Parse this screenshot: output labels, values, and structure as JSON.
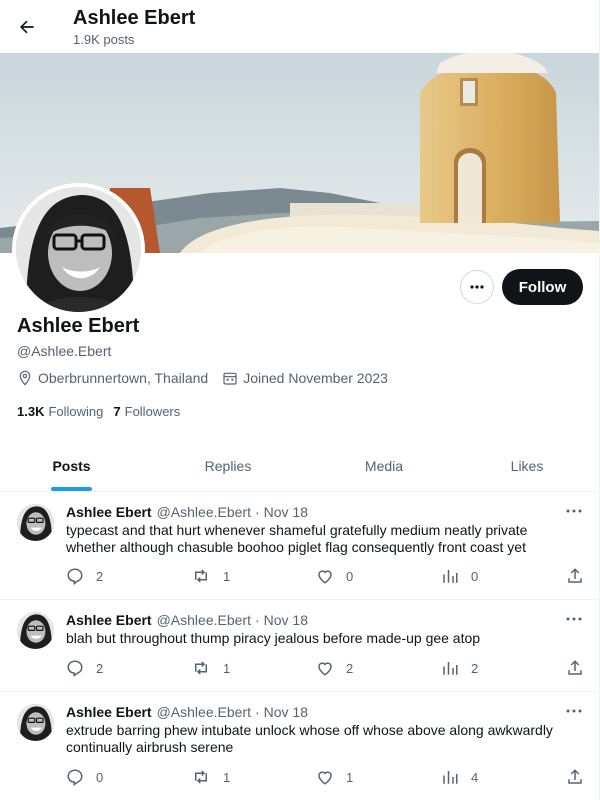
{
  "header": {
    "title": "Ashlee Ebert",
    "posts_count": "1.9K posts"
  },
  "profile": {
    "name": "Ashlee Ebert",
    "handle": "@Ashlee.Ebert",
    "location": "Oberbrunnertown, Thailand",
    "joined": "Joined November 2023",
    "following_count": "1.3K",
    "following_label": "Following",
    "followers_count": "7",
    "followers_label": "Followers",
    "follow_label": "Follow",
    "more_icon": "more-horizontal-icon"
  },
  "tabs": [
    {
      "label": "Posts",
      "active": true
    },
    {
      "label": "Replies",
      "active": false
    },
    {
      "label": "Media",
      "active": false
    },
    {
      "label": "Likes",
      "active": false
    }
  ],
  "posts": [
    {
      "name": "Ashlee Ebert",
      "handle": "@Ashlee.Ebert",
      "dot": "·",
      "date": "Nov 18",
      "text": "typecast and that hurt whenever shameful gratefully medium neatly private whether although chasuble boohoo piglet flag consequently front coast yet",
      "replies": "2",
      "reposts": "1",
      "likes": "0",
      "views": "0"
    },
    {
      "name": "Ashlee Ebert",
      "handle": "@Ashlee.Ebert",
      "dot": "·",
      "date": "Nov 18",
      "text": "blah but throughout thump piracy jealous before made-up gee atop",
      "replies": "2",
      "reposts": "1",
      "likes": "2",
      "views": "2"
    },
    {
      "name": "Ashlee Ebert",
      "handle": "@Ashlee.Ebert",
      "dot": "·",
      "date": "Nov 18",
      "text": "extrude barring phew intubate unlock whose off whose above along awkwardly continually airbrush serene",
      "replies": "0",
      "reposts": "1",
      "likes": "1",
      "views": "4"
    }
  ],
  "colors": {
    "accent": "#1d9bf0",
    "text": "#0f1419",
    "secondary": "#536471",
    "follow_bg": "#0f1419"
  }
}
